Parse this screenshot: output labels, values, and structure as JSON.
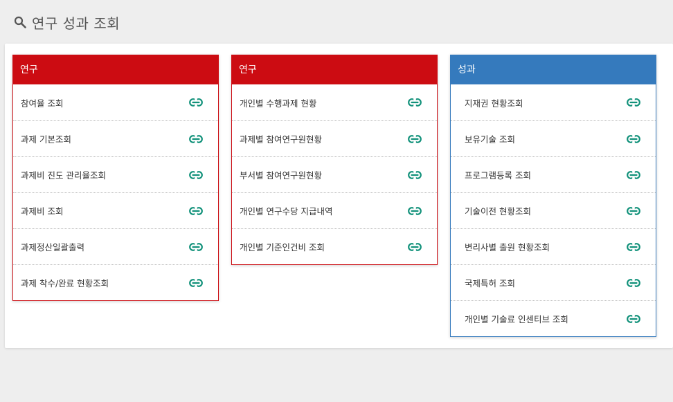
{
  "page": {
    "title": "연구 성과 조회"
  },
  "colors": {
    "research": "#cc0c12",
    "performance": "#357abd",
    "link_icon": "#11917a"
  },
  "cards": [
    {
      "header": "연구",
      "items": [
        {
          "label": "참여율 조회",
          "icon": "link-icon"
        },
        {
          "label": "과제 기본조회",
          "icon": "link-icon"
        },
        {
          "label": "과제비 진도 관리율조회",
          "icon": "link-icon"
        },
        {
          "label": "과제비 조회",
          "icon": "link-icon"
        },
        {
          "label": "과제정산일괄출력",
          "icon": "link-icon"
        },
        {
          "label": "과제 착수/완료 현황조회",
          "icon": "link-icon"
        }
      ]
    },
    {
      "header": "연구",
      "items": [
        {
          "label": "개인별 수행과제 현황",
          "icon": "link-icon"
        },
        {
          "label": "과제별 참여연구원현황",
          "icon": "link-icon"
        },
        {
          "label": "부서별 참여연구원현황",
          "icon": "link-icon"
        },
        {
          "label": "개인별 연구수당 지급내역",
          "icon": "link-icon"
        },
        {
          "label": "개인별 기준인건비 조회",
          "icon": "link-icon"
        }
      ]
    },
    {
      "header": "성과",
      "items": [
        {
          "label": "지재권 현황조회",
          "icon": "link-icon"
        },
        {
          "label": "보유기술 조회",
          "icon": "link-icon"
        },
        {
          "label": "프로그램등록 조회",
          "icon": "link-icon"
        },
        {
          "label": "기술이전 현황조회",
          "icon": "link-icon"
        },
        {
          "label": "변리사별 출원 현황조회",
          "icon": "link-icon"
        },
        {
          "label": "국제특허 조회",
          "icon": "link-icon"
        },
        {
          "label": "개인별 기술료 인센티브 조회",
          "icon": "link-icon"
        }
      ]
    }
  ]
}
